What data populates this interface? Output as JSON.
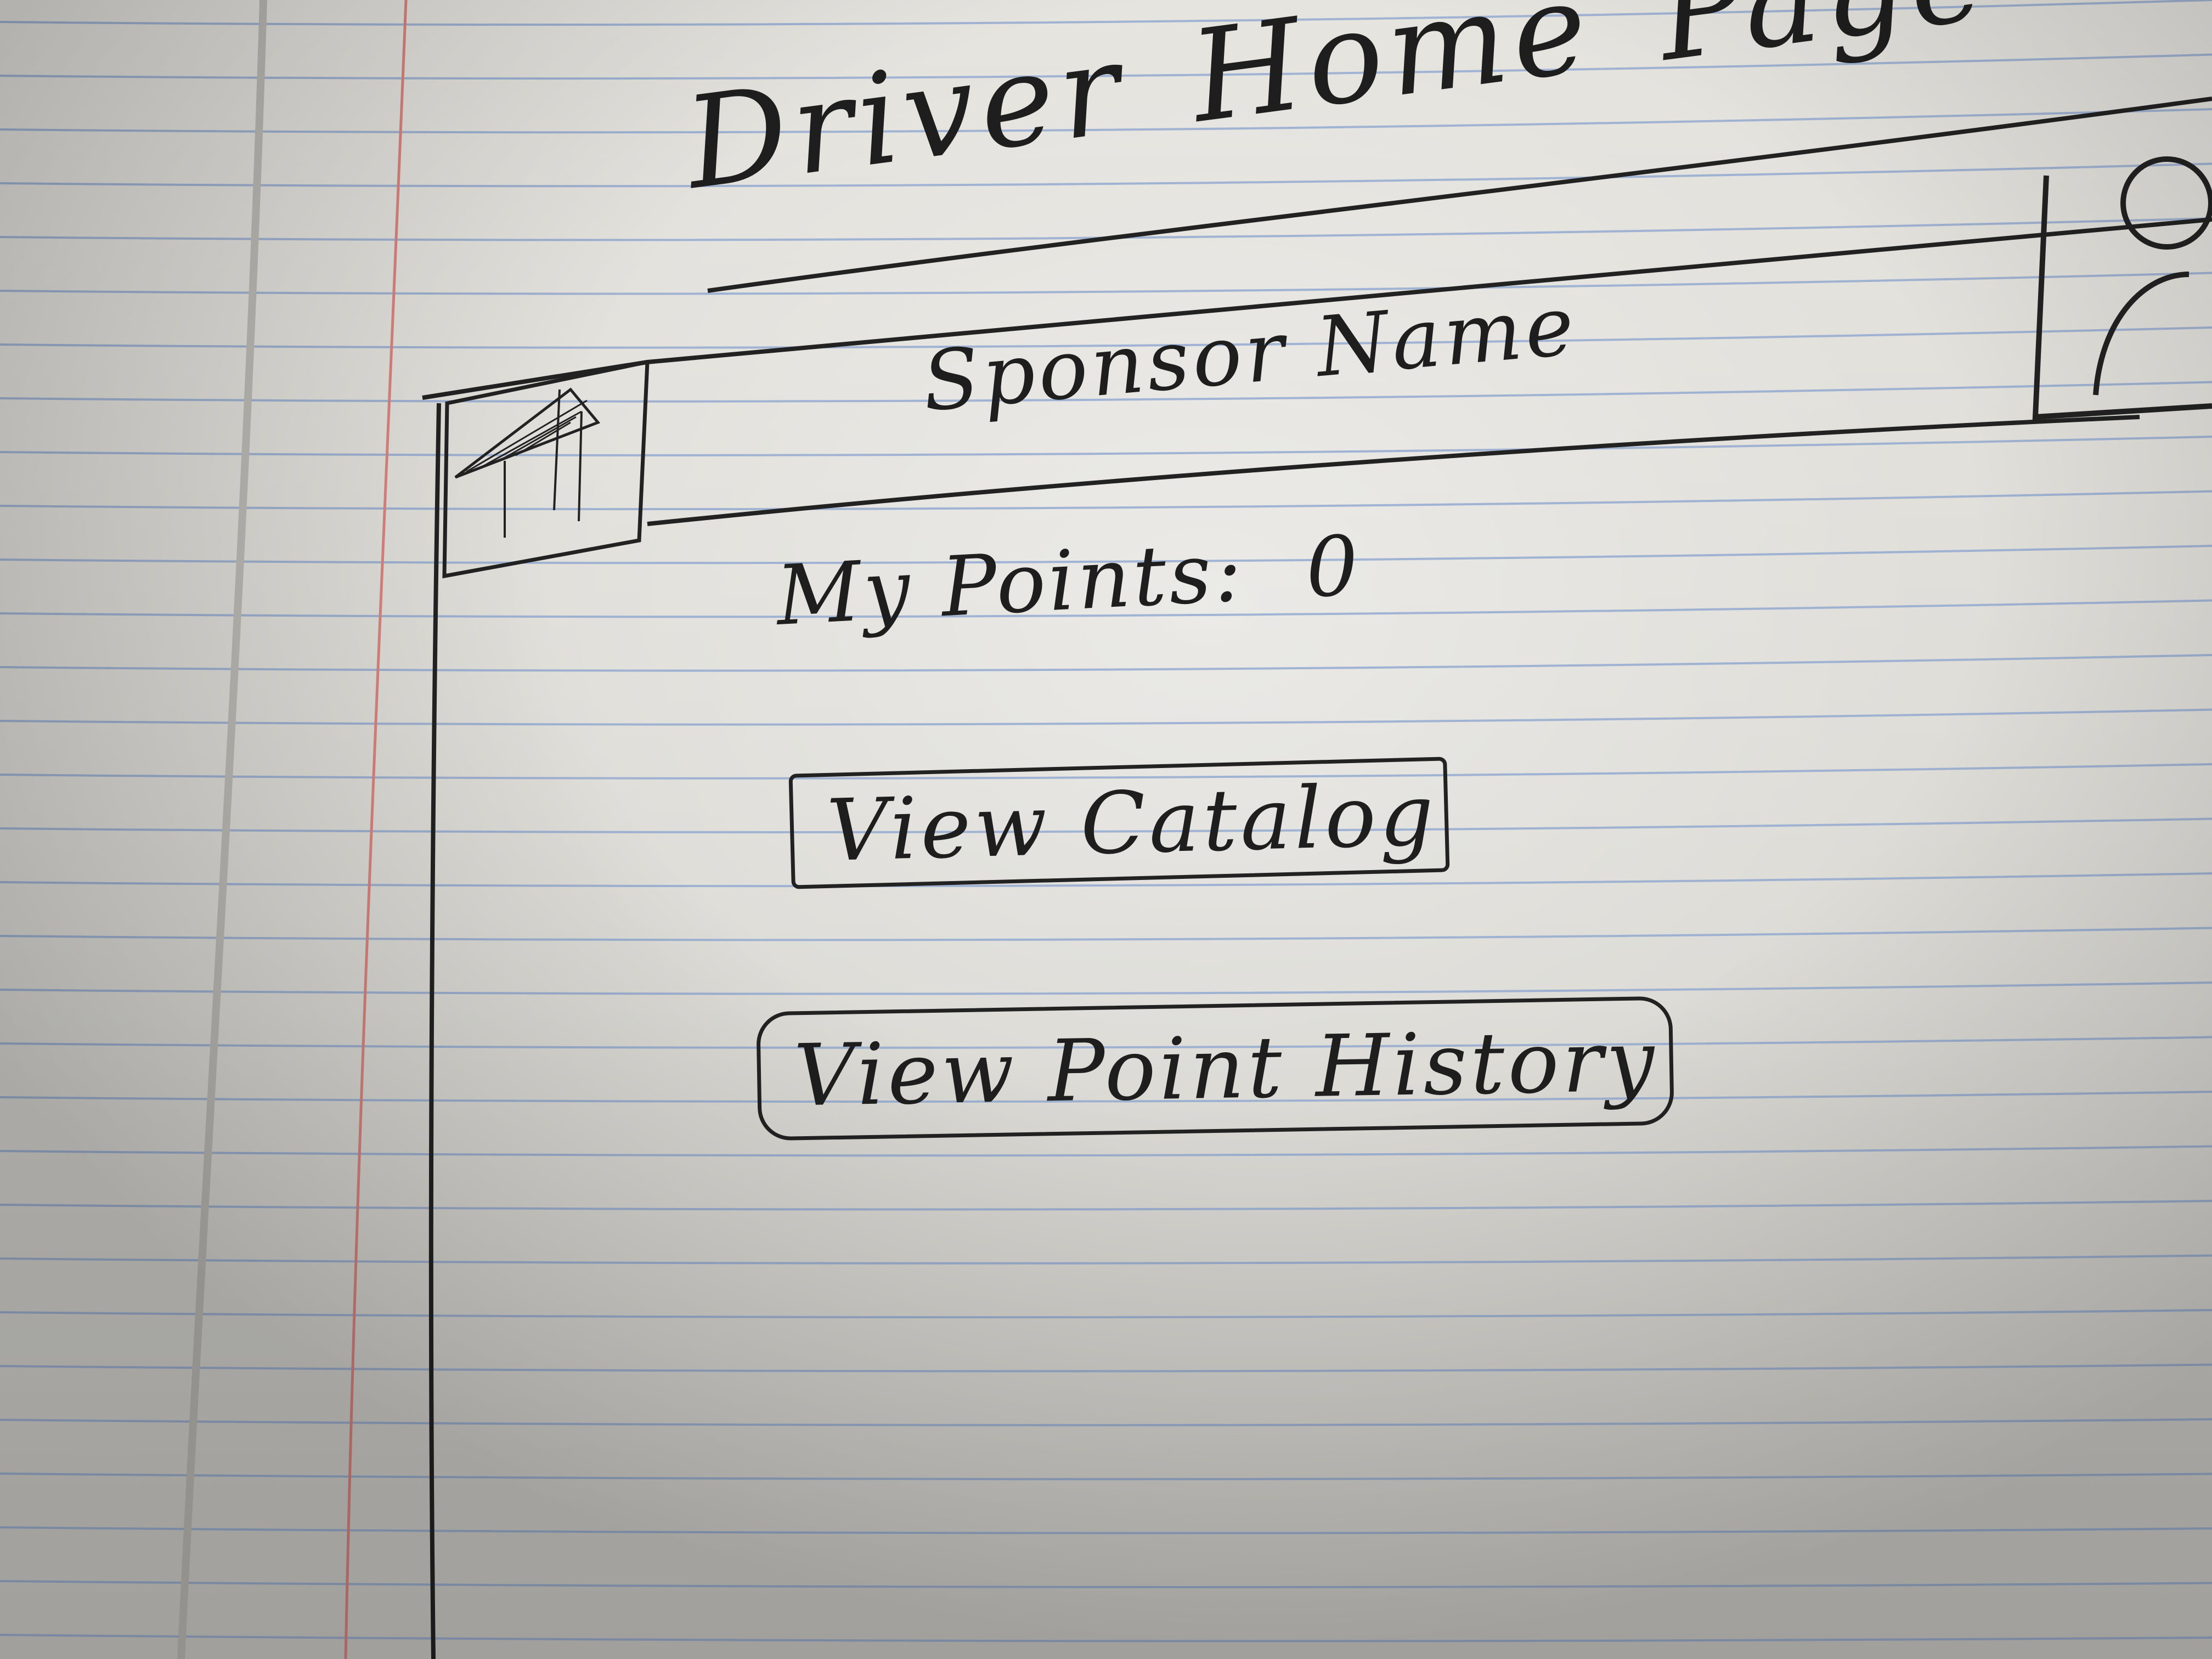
{
  "page": {
    "title_words": [
      "Driver",
      "Home",
      "Page"
    ]
  },
  "header": {
    "sponsor_name": "Sponsor Name",
    "logo_icon": "sponsor-logo-icon",
    "avatar_icon": "user-avatar-icon"
  },
  "points": {
    "label": "My Points:",
    "value": "0"
  },
  "actions": {
    "view_catalog_label": "View Catalog",
    "view_point_history_label": "View Point History"
  },
  "colors": {
    "ink": "#1e1e1e",
    "paper": "#e2e1dc",
    "rule_blue": "#8fa6cf",
    "margin_red": "#d9847f"
  }
}
